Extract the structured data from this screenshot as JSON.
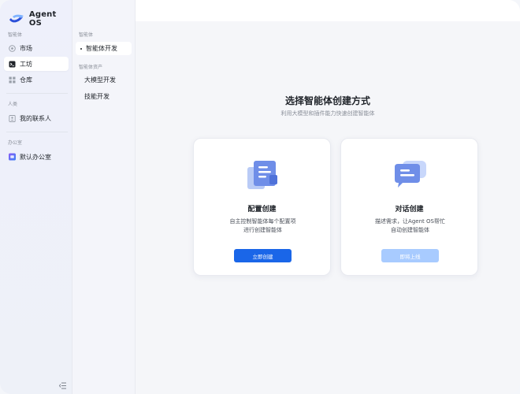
{
  "app": {
    "name": "Agent OS"
  },
  "sidebar": {
    "sections": [
      {
        "label": "智能体"
      },
      {
        "label": "人类"
      },
      {
        "label": "办公室"
      }
    ],
    "items": [
      {
        "label": "市场",
        "icon": "market-icon"
      },
      {
        "label": "工坊",
        "icon": "workshop-icon",
        "active": true
      },
      {
        "label": "仓库",
        "icon": "warehouse-icon"
      },
      {
        "label": "我的联系人",
        "icon": "contacts-icon"
      },
      {
        "label": "默认办公室",
        "icon": "office-icon"
      }
    ]
  },
  "subnav": {
    "sections": [
      {
        "label": "智能体"
      },
      {
        "label": "智能体资产"
      }
    ],
    "items": [
      {
        "label": "智能体开发",
        "active": true
      },
      {
        "label": "大模型开发"
      },
      {
        "label": "技能开发"
      }
    ]
  },
  "main": {
    "heading": "选择智能体创建方式",
    "subheading": "利用大模型和插件能力快速创建智能体",
    "cards": [
      {
        "title": "配置创建",
        "desc_line1": "自主控制智能体每个配置项",
        "desc_line2": "进行创建智能体",
        "button": "立即创建",
        "button_state": "enabled"
      },
      {
        "title": "对话创建",
        "desc_line1": "描述需求，让Agent OS帮忙",
        "desc_line2": "自动创建智能体",
        "button": "即将上线",
        "button_state": "disabled"
      }
    ]
  },
  "colors": {
    "primary": "#1a66e8",
    "primary_disabled": "#a8cbff",
    "illustration": "#6f8ee8"
  }
}
